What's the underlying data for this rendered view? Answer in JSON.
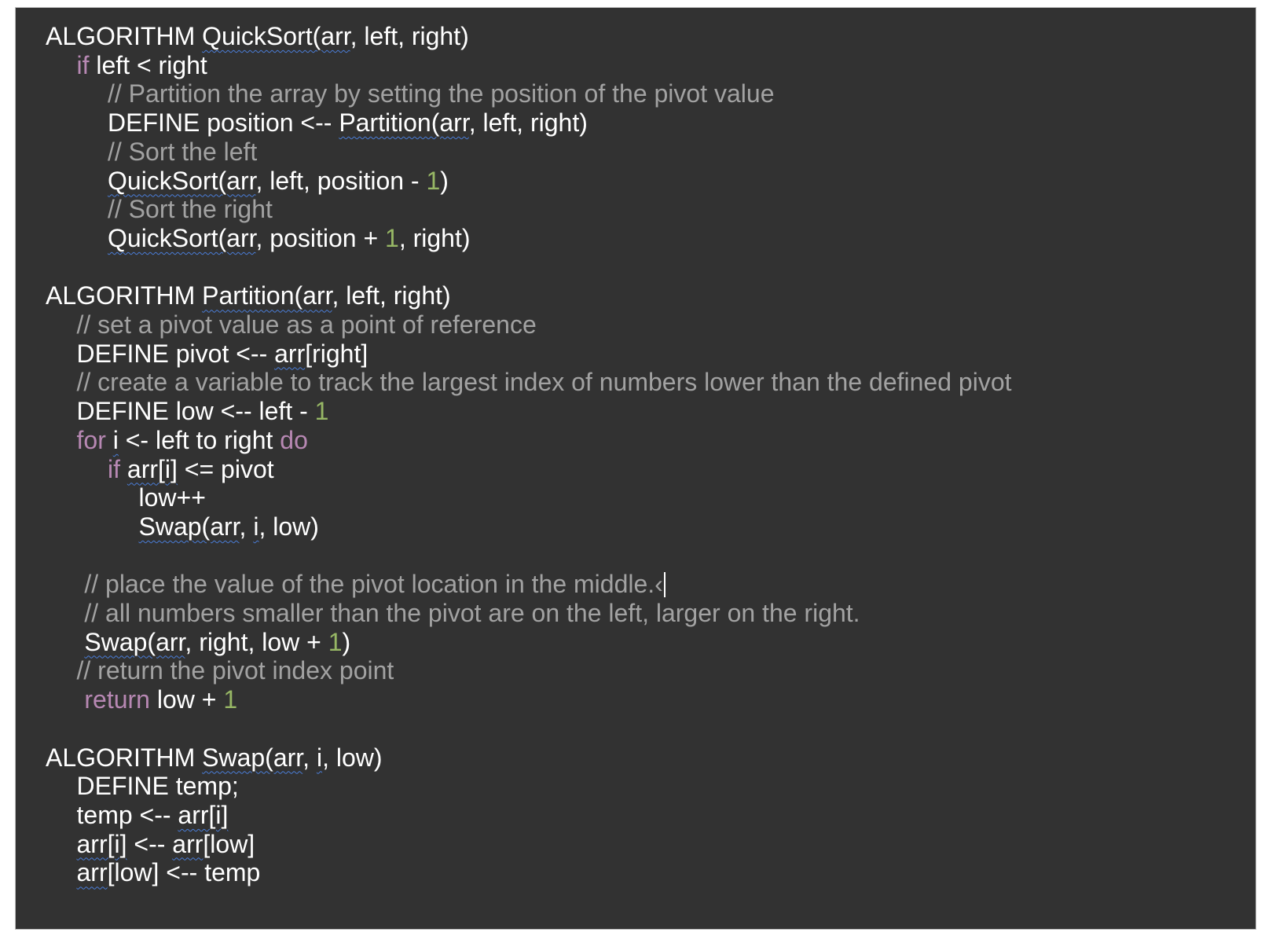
{
  "editor": {
    "background": "#323232",
    "colors": {
      "text": "#ffffff",
      "keyword": "#b788b3",
      "comment": "#a2a2a2",
      "number": "#97b765",
      "spellcheck": "#4a7dd8"
    },
    "caret_after_line": 19,
    "lines": [
      {
        "indent": 0,
        "tokens": [
          {
            "t": "ALGORITHM "
          },
          {
            "t": "QuickSort(arr",
            "s": "sp"
          },
          {
            "t": ", left, right)"
          }
        ]
      },
      {
        "indent": 1,
        "tokens": [
          {
            "t": "if",
            "s": "kw"
          },
          {
            "t": " left < right"
          }
        ]
      },
      {
        "indent": 2,
        "tokens": [
          {
            "t": "// Partition the array by setting the position of the pivot value",
            "s": "cm"
          }
        ]
      },
      {
        "indent": 2,
        "tokens": [
          {
            "t": "DEFINE position <-- "
          },
          {
            "t": "Partition(arr",
            "s": "sp"
          },
          {
            "t": ", left, right)"
          }
        ]
      },
      {
        "indent": 2,
        "tokens": [
          {
            "t": "// Sort the left",
            "s": "cm"
          }
        ]
      },
      {
        "indent": 2,
        "tokens": [
          {
            "t": "QuickSort(arr",
            "s": "sp"
          },
          {
            "t": ", left, position - "
          },
          {
            "t": "1",
            "s": "num"
          },
          {
            "t": ")"
          }
        ]
      },
      {
        "indent": 2,
        "tokens": [
          {
            "t": "// Sort the right",
            "s": "cm"
          }
        ]
      },
      {
        "indent": 2,
        "tokens": [
          {
            "t": "QuickSort(arr",
            "s": "sp"
          },
          {
            "t": ", position + "
          },
          {
            "t": "1",
            "s": "num"
          },
          {
            "t": ", right)"
          }
        ]
      },
      {
        "indent": 0,
        "tokens": []
      },
      {
        "indent": 0,
        "tokens": [
          {
            "t": "ALGORITHM "
          },
          {
            "t": "Partition(arr",
            "s": "sp"
          },
          {
            "t": ", left, right)"
          }
        ]
      },
      {
        "indent": 1,
        "tokens": [
          {
            "t": "// set a pivot value as a point of reference",
            "s": "cm"
          }
        ]
      },
      {
        "indent": 1,
        "tokens": [
          {
            "t": "DEFINE pivot <-- "
          },
          {
            "t": "arr",
            "s": "sp"
          },
          {
            "t": "[right]"
          }
        ]
      },
      {
        "indent": 1,
        "tokens": [
          {
            "t": "// create a variable to track the largest index of numbers lower than the defined pivot",
            "s": "cm"
          }
        ]
      },
      {
        "indent": 1,
        "tokens": [
          {
            "t": "DEFINE low <-- left - "
          },
          {
            "t": "1",
            "s": "num"
          }
        ]
      },
      {
        "indent": 1,
        "tokens": [
          {
            "t": "for",
            "s": "kw"
          },
          {
            "t": " "
          },
          {
            "t": "i",
            "s": "sp"
          },
          {
            "t": " <- left to right "
          },
          {
            "t": "do",
            "s": "kw"
          }
        ]
      },
      {
        "indent": 2,
        "tokens": [
          {
            "t": "if",
            "s": "kw"
          },
          {
            "t": " "
          },
          {
            "t": "arr[i]",
            "s": "sp"
          },
          {
            "t": " <= pivot"
          }
        ]
      },
      {
        "indent": 3,
        "tokens": [
          {
            "t": "low++"
          }
        ]
      },
      {
        "indent": 3,
        "tokens": [
          {
            "t": "Swap(arr",
            "s": "sp"
          },
          {
            "t": ", "
          },
          {
            "t": "i",
            "s": "sp"
          },
          {
            "t": ", low)"
          }
        ]
      },
      {
        "indent": 0,
        "tokens": []
      },
      {
        "indent": 1.25,
        "tokens": [
          {
            "t": "// place the value of the pivot location in the middle.‹",
            "s": "cm"
          }
        ]
      },
      {
        "indent": 1.25,
        "tokens": [
          {
            "t": "// all numbers smaller than the pivot are on the left, larger on the right.",
            "s": "cm"
          }
        ]
      },
      {
        "indent": 1.25,
        "tokens": [
          {
            "t": "Swap(arr",
            "s": "sp"
          },
          {
            "t": ", right, low + "
          },
          {
            "t": "1",
            "s": "num"
          },
          {
            "t": ")"
          }
        ]
      },
      {
        "indent": 1,
        "tokens": [
          {
            "t": "// return the pivot index point",
            "s": "cm"
          }
        ]
      },
      {
        "indent": 1.25,
        "tokens": [
          {
            "t": "return",
            "s": "kw"
          },
          {
            "t": " low + "
          },
          {
            "t": "1",
            "s": "num"
          }
        ]
      },
      {
        "indent": 0,
        "tokens": []
      },
      {
        "indent": 0,
        "tokens": [
          {
            "t": "ALGORITHM "
          },
          {
            "t": "Swap(arr",
            "s": "sp"
          },
          {
            "t": ", "
          },
          {
            "t": "i",
            "s": "sp"
          },
          {
            "t": ", low)"
          }
        ]
      },
      {
        "indent": 1,
        "tokens": [
          {
            "t": "DEFINE temp;"
          }
        ]
      },
      {
        "indent": 1,
        "tokens": [
          {
            "t": "temp <-- "
          },
          {
            "t": "arr[i]",
            "s": "sp"
          }
        ]
      },
      {
        "indent": 1,
        "tokens": [
          {
            "t": "arr[i]",
            "s": "sp"
          },
          {
            "t": " <-- "
          },
          {
            "t": "arr",
            "s": "sp"
          },
          {
            "t": "[low]"
          }
        ]
      },
      {
        "indent": 1,
        "tokens": [
          {
            "t": "arr",
            "s": "sp"
          },
          {
            "t": "[low] <-- temp"
          }
        ]
      }
    ]
  }
}
